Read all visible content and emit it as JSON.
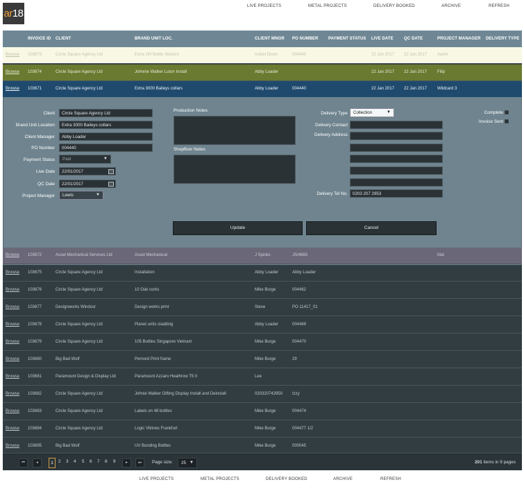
{
  "logo": {
    "text_a": "ar",
    "text_b": "18"
  },
  "nav": [
    "LIVE PROJECTS",
    "METAL PROJECTS",
    "DELIVERY BOOKED",
    "ARCHIVE",
    "REFRESH"
  ],
  "columns": [
    "INVOICE ID",
    "CLIENT",
    "BRAND UNIT LOC.",
    "CLIENT MNGR",
    "PO NUMBER",
    "PAYMENT STATUS",
    "LIVE DATE",
    "QC DATE",
    "PROJECT MANAGER",
    "DELIVERY TYPE"
  ],
  "rows_top": [
    {
      "browse": "Browse",
      "id": "103673",
      "client": "Circle Square Agency Ltd",
      "brand": "Extra JW Bottle Stickers",
      "mngr": "Isobel Dixon",
      "po": "004440",
      "pay": "",
      "live": "22 Jan 2017",
      "qc": "22 Jan 2017",
      "pm": "Aamir",
      "dtype": ""
    },
    {
      "browse": "Browse",
      "id": "103674",
      "client": "Circle Square Agency Ltd",
      "brand": "Johnnie Walker Luton Install",
      "mngr": "Abby Loader",
      "po": "",
      "pay": "",
      "live": "22 Jan 2017",
      "qc": "22 Jan 2017",
      "pm": "Filip",
      "dtype": ""
    },
    {
      "browse": "Browse",
      "id": "103671",
      "client": "Circle Square Agency Ltd",
      "brand": "Extra 3000 Baileys collars",
      "mngr": "Abby Loader",
      "po": "004440",
      "pay": "",
      "live": "22 Jan 2017",
      "qc": "22 Jan 2017",
      "pm": "Wildcard 3",
      "dtype": ""
    }
  ],
  "edit": {
    "client_label": "Client",
    "client": "Circle Square Agency Ltd",
    "brand_label": "Brand Unit Location",
    "brand": "Extra 3000 Baileys collars",
    "mngr_label": "Client Manager",
    "mngr": "Abby Loader",
    "po_label": "PO Number",
    "po": "004440",
    "pay_label": "Payment Status",
    "pay": "Paid",
    "live_label": "Live Date",
    "live": "22/01/2017",
    "qc_label": "QC Date",
    "qc": "22/01/2017",
    "pm_label": "Project Manager",
    "pm": "Lewis",
    "prod_notes_label": "Production Notes",
    "shop_notes_label": "Shopfloor Notes",
    "dtype_label": "Delivery Type",
    "dtype": "Collection",
    "dcontact_label": "Delivery Contact",
    "daddress_label": "Delivery Address",
    "dtel_label": "Delivery Tel No.",
    "dtel": "0203 207 2953",
    "complete_label": "Complete",
    "invoice_label": "Invoice Sent",
    "update": "Update",
    "cancel": "Cancel"
  },
  "rows_bottom": [
    {
      "browse": "Browse",
      "id": "103672",
      "client": "Asset Mechanical Services Ltd",
      "brand": "Asset Mechanical",
      "mngr": "J Spinks",
      "po": "JS/4883",
      "pay": "",
      "live": "",
      "qc": "",
      "pm": "Mat",
      "dtype": ""
    },
    {
      "browse": "Browse",
      "id": "103675",
      "client": "Circle Square Agency Ltd",
      "brand": "Installation",
      "mngr": "Abby Loader",
      "po": "Abby Loader",
      "pay": "",
      "live": "",
      "qc": "",
      "pm": "",
      "dtype": ""
    },
    {
      "browse": "Browse",
      "id": "103676",
      "client": "Circle Square Agency Ltd",
      "brand": "10 Oak corks",
      "mngr": "Mike Burge",
      "po": "004462",
      "pay": "",
      "live": "",
      "qc": "",
      "pm": "",
      "dtype": ""
    },
    {
      "browse": "Browse",
      "id": "103677",
      "client": "Designworks Windsor",
      "brand": "Design works print",
      "mngr": "Steve",
      "po": "PO 11417_01",
      "pay": "",
      "live": "",
      "qc": "",
      "pm": "",
      "dtype": ""
    },
    {
      "browse": "Browse",
      "id": "103678",
      "client": "Circle Square Agency Ltd",
      "brand": "Planet units cladding",
      "mngr": "Abby Loader",
      "po": "004469",
      "pay": "",
      "live": "",
      "qc": "",
      "pm": "",
      "dtype": ""
    },
    {
      "browse": "Browse",
      "id": "103679",
      "client": "Circle Square Agency Ltd",
      "brand": "105 Bottles Singapore Vietnam",
      "mngr": "Mike Burge",
      "po": "004470",
      "pay": "",
      "live": "",
      "qc": "",
      "pm": "",
      "dtype": ""
    },
    {
      "browse": "Browse",
      "id": "103680",
      "client": "Big Bad Wolf",
      "brand": "Pernord Print frame",
      "mngr": "Mike Burge",
      "po": "29",
      "pay": "",
      "live": "",
      "qc": "",
      "pm": "",
      "dtype": ""
    },
    {
      "browse": "Browse",
      "id": "103681",
      "client": "Paramount Design & Display Ltd",
      "brand": "Paramount Azzaro Heathrow T5 II",
      "mngr": "Lee",
      "po": "",
      "pay": "",
      "live": "",
      "qc": "",
      "pm": "",
      "dtype": ""
    },
    {
      "browse": "Browse",
      "id": "103682",
      "client": "Circle Square Agency Ltd",
      "brand": "Johnie Walker Gifting Display Install and Deinstall",
      "mngr": "020320742950",
      "po": "Izzy",
      "pay": "",
      "live": "",
      "qc": "",
      "pm": "",
      "dtype": ""
    },
    {
      "browse": "Browse",
      "id": "103683",
      "client": "Circle Square Agency Ltd",
      "brand": "Labels on 48 bottles",
      "mngr": "Mike Burge",
      "po": "004474",
      "pay": "",
      "live": "",
      "qc": "",
      "pm": "",
      "dtype": ""
    },
    {
      "browse": "Browse",
      "id": "103684",
      "client": "Circle Square Agency Ltd",
      "brand": "Logic Vitrines Frankfurt",
      "mngr": "Mike Burge",
      "po": "004477 1/2",
      "pay": "",
      "live": "",
      "qc": "",
      "pm": "",
      "dtype": ""
    },
    {
      "browse": "Browse",
      "id": "103695",
      "client": "Big Bad Wolf",
      "brand": "UV Bonding Bottles",
      "mngr": "Mike Burge",
      "po": "000045",
      "pay": "",
      "live": "",
      "qc": "",
      "pm": "",
      "dtype": ""
    }
  ],
  "pager": {
    "first": "⏮",
    "prev": "◂",
    "next": "▸",
    "last": "⏭",
    "pages": [
      "1",
      "2",
      "3",
      "4",
      "5",
      "6",
      "7",
      "8",
      "9"
    ],
    "current": "1",
    "size_label": "Page size:",
    "size": "25",
    "summary_count": "201",
    "summary_text": "items in 9 pages"
  }
}
